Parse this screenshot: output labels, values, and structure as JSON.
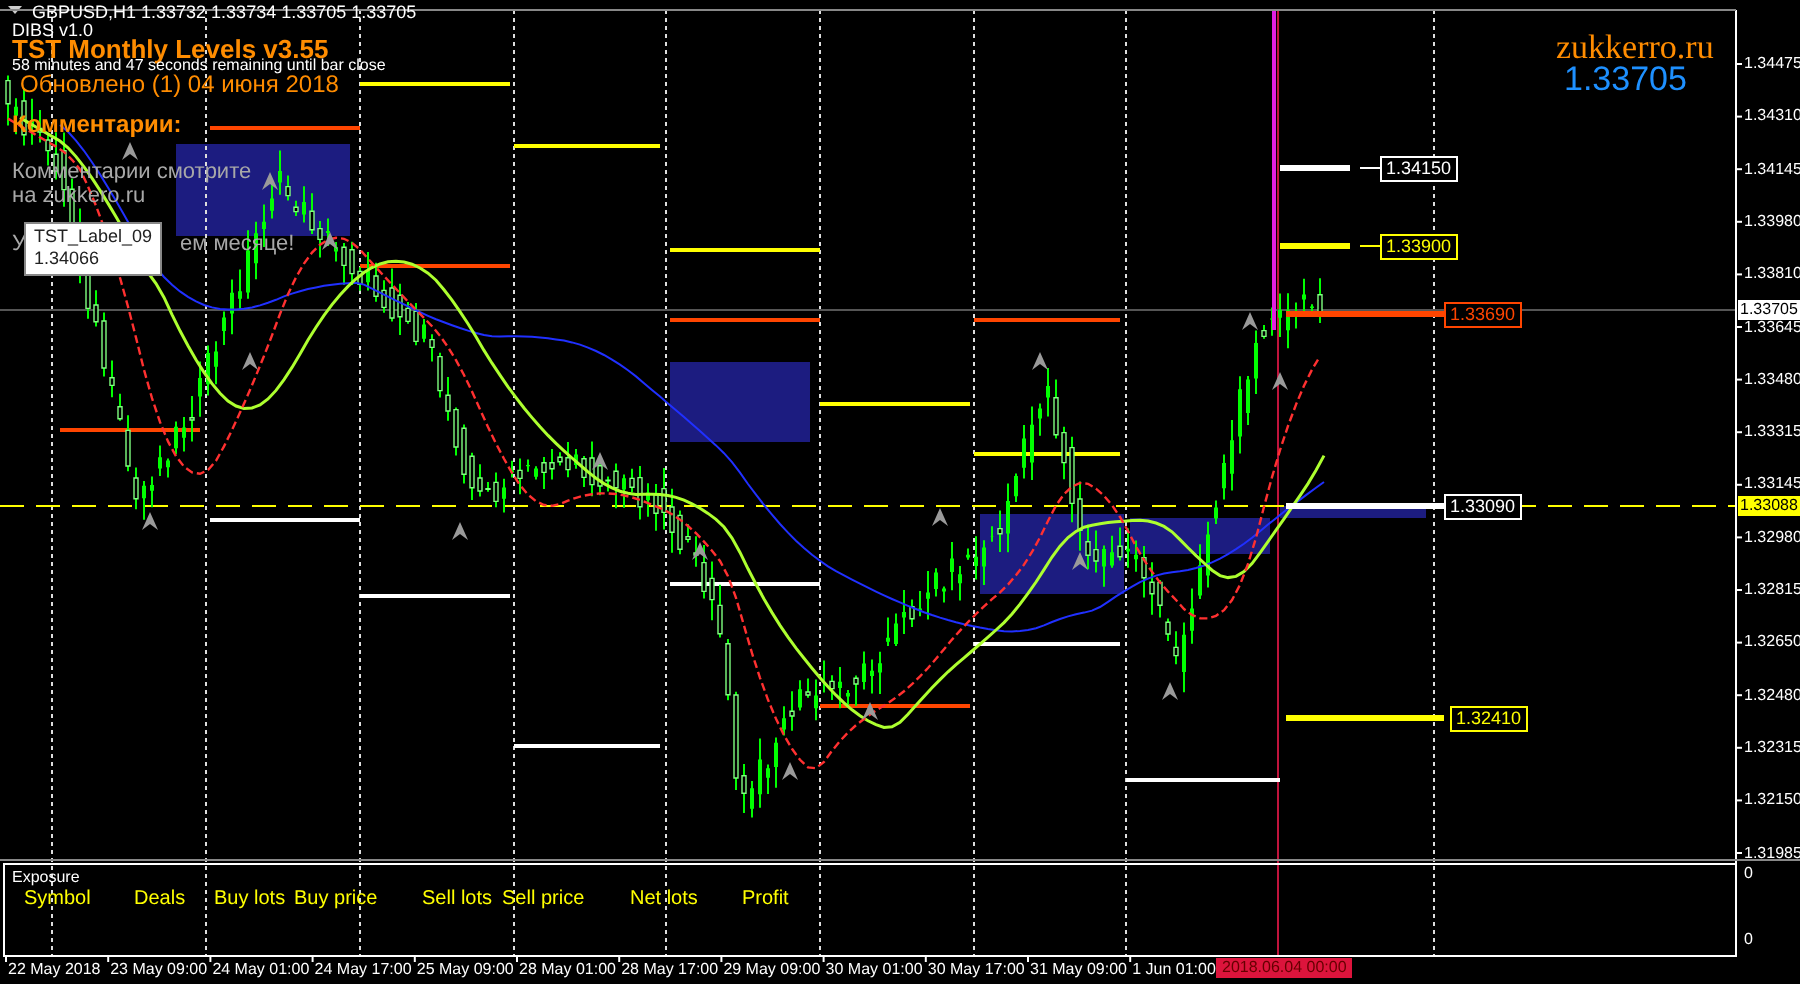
{
  "chart_header": {
    "symbol_line": "GBPUSD,H1  1.33732 1.33734 1.33705 1.33705"
  },
  "chart_texts": [
    {
      "kind": "indicator",
      "text": "DIBS v1.0"
    },
    {
      "kind": "title",
      "text": "TST Monthly Levels v3.55"
    },
    {
      "kind": "status",
      "text": "58 minutes and 47 seconds remaining until bar close"
    },
    {
      "kind": "update",
      "text": "Обновлено (1)   04 июня 2018"
    },
    {
      "kind": "heading",
      "text": "Комментарии:"
    },
    {
      "kind": "comment",
      "text": "Комментарии смотрите"
    },
    {
      "kind": "comment",
      "text": "на zukkero.ru"
    },
    {
      "kind": "comment",
      "text": "У"
    },
    {
      "kind": "comment",
      "text": "ем месяце!"
    }
  ],
  "tooltip": {
    "name": "TST_Label_09",
    "value": "1.34066"
  },
  "site_label": {
    "site": "zukkerro.ru",
    "price": "1.33705"
  },
  "price_levels": [
    {
      "value": "1.34150",
      "color": "#ffffff"
    },
    {
      "value": "1.33900",
      "color": "#ffff00"
    },
    {
      "value": "1.33690",
      "color": "#ff4500"
    },
    {
      "value": "1.33090",
      "color": "#ffffff"
    },
    {
      "value": "1.32410",
      "color": "#ffff00"
    }
  ],
  "price_axis": {
    "ticks": [
      "1.34475",
      "1.34310",
      "1.34145",
      "1.33980",
      "1.33810",
      "1.33645",
      "1.33480",
      "1.33315",
      "1.33145",
      "1.32980",
      "1.32815",
      "1.32650",
      "1.32480",
      "1.32315",
      "1.32150",
      "1.31985"
    ],
    "current_price": "1.33705",
    "line_price": "1.33088"
  },
  "exposure_panel": {
    "title": "Exposure",
    "columns": [
      "Symbol",
      "Deals",
      "Buy lots",
      "Buy price",
      "Sell lots",
      "Sell price",
      "Net lots",
      "Profit"
    ],
    "scale": [
      "0",
      "0"
    ]
  },
  "time_axis": {
    "labels": [
      "22 May 2018",
      "23 May 09:00",
      "24 May 01:00",
      "24 May 17:00",
      "25 May 09:00",
      "28 May 01:00",
      "28 May 17:00",
      "29 May 09:00",
      "30 May 01:00",
      "30 May 17:00",
      "31 May 09:00",
      "1 Jun 01:00"
    ],
    "current_time": "2018.06.04 00:00"
  }
}
